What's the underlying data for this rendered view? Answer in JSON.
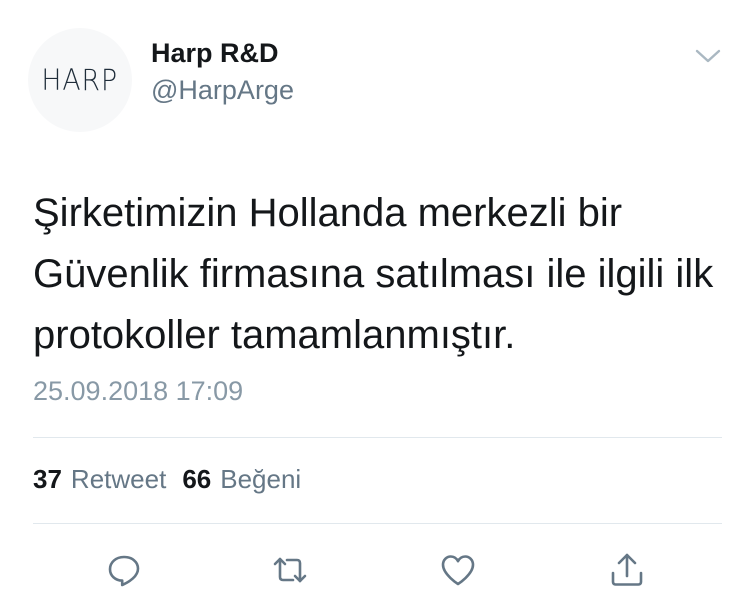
{
  "author": {
    "avatar_text": "HARP",
    "display_name": "Harp R&D",
    "handle": "@HarpArge"
  },
  "tweet": {
    "text": "Şirketimizin Hollanda merkezli bir\nGüvenlik firmasına satılması ile ilgili ilk\nprotokoller tamamlanmıştır.",
    "timestamp": "25.09.2018 17:09"
  },
  "stats": {
    "retweets_count": "37",
    "retweets_label": "Retweet",
    "likes_count": "66",
    "likes_label": "Beğeni"
  },
  "actions": {
    "reply_icon": "reply-icon",
    "retweet_icon": "retweet-icon",
    "like_icon": "heart-icon",
    "share_icon": "share-icon",
    "menu_icon": "chevron-down-icon"
  },
  "colors": {
    "primary_text": "#14171a",
    "secondary_text": "#657786",
    "timestamp": "#8899a6",
    "divider": "#e1e8ed"
  }
}
